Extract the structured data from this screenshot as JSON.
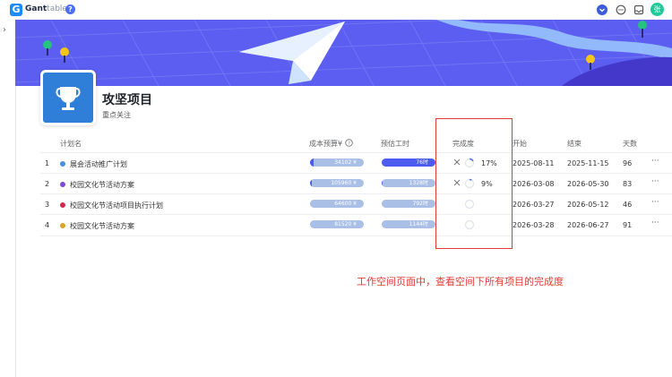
{
  "app": {
    "brand_main": "Gant",
    "brand_light": "table",
    "help": "?",
    "user_initial": "张"
  },
  "project": {
    "title": "攻坚项目",
    "subtitle": "重点关注"
  },
  "table": {
    "headers": {
      "name": "计划名",
      "budget": "成本预算¥",
      "hours": "预估工时",
      "progress": "完成度",
      "start": "开始",
      "end": "结束",
      "days": "天数"
    },
    "rows": [
      {
        "index": "1",
        "name": "展会活动推广计划",
        "color": "#4a90e2",
        "budget": "34102 ¥",
        "budget_fill": 0.06,
        "hours": "76时",
        "hours_fill": 1.0,
        "progress": "17%",
        "progress_value": 0.17,
        "start": "2025-08-11",
        "end": "2025-11-15",
        "days": "96"
      },
      {
        "index": "2",
        "name": "校园文化节活动方案",
        "color": "#7c4ddb",
        "budget": "105960 ¥",
        "budget_fill": 0.03,
        "hours": "1328时",
        "hours_fill": 0.02,
        "progress": "9%",
        "progress_value": 0.09,
        "start": "2026-03-08",
        "end": "2026-05-30",
        "days": "83"
      },
      {
        "index": "3",
        "name": "校园文化节活动项目执行计划",
        "color": "#d6284a",
        "budget": "64600 ¥",
        "budget_fill": 0,
        "hours": "792时",
        "hours_fill": 0,
        "progress": "",
        "progress_value": 0,
        "start": "2026-03-27",
        "end": "2026-05-12",
        "days": "46"
      },
      {
        "index": "4",
        "name": "校园文化节活动方案",
        "color": "#d9a52b",
        "budget": "81520 ¥",
        "budget_fill": 0,
        "hours": "1144时",
        "hours_fill": 0,
        "progress": "",
        "progress_value": 0,
        "start": "2026-03-28",
        "end": "2026-06-27",
        "days": "91"
      }
    ],
    "more": "···"
  },
  "annotation": "工作空间页面中，查看空间下所有项目的完成度",
  "colors": {
    "accent": "#4c5bf0",
    "bar_bg": "#a9bfe6",
    "highlight": "#e53935"
  }
}
